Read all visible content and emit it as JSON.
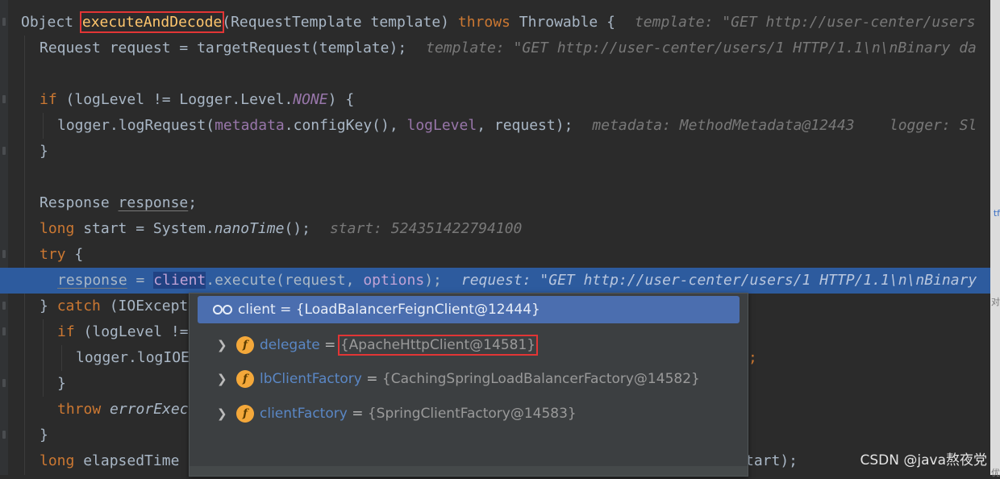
{
  "editor": {
    "method_signature": {
      "ret": "Object ",
      "name": "executeAndDecode",
      "params": "(RequestTemplate template) ",
      "kw": "throws",
      "rest": " Throwable {",
      "hint": "template: \"GET http://user-center/users"
    },
    "lines": {
      "l1": {
        "a": "Request request = targetRequest(template);",
        "hint": "template: \"GET http://user-center/users/1 HTTP/1.1\\n\\nBinary da"
      },
      "l3": {
        "kw": "if",
        "a": " (logLevel != Logger.Level.",
        "fld": "NONE",
        "b": ") {"
      },
      "l4": {
        "a": "logger.logRequest(",
        "fld": "metadata",
        "b": ".configKey(), ",
        "fld2": "logLevel",
        "c": ", request);",
        "hint": "metadata: MethodMetadata@12443    logger: Sl"
      },
      "l5": {
        "a": "}"
      },
      "l7": {
        "a": "Response ",
        "var": "response",
        "b": ";"
      },
      "l8": {
        "kw": "long",
        "a": " start = System.",
        "it": "nanoTime",
        "b": "();",
        "hint": "start: 524351422794100"
      },
      "l9": {
        "kw": "try",
        "a": " {"
      },
      "l10": {
        "var": "response",
        "a": " = ",
        "sel": "client",
        "b": ".execute(request, ",
        "fld": "options",
        "c": ");",
        "hint": "request: \"GET http://user-center/users/1 HTTP/1.1\\n\\nBinary"
      },
      "l11": {
        "a": "} ",
        "kw": "catch",
        "b": " (IOExcept"
      },
      "l12": {
        "kw": "if",
        "a": " (logLevel !="
      },
      "l13": {
        "a": "logger.logIOE",
        "tail": ";"
      },
      "l14": {
        "a": "}"
      },
      "l15": {
        "kw": "throw",
        "it": " errorExec"
      },
      "l16": {
        "a": "}"
      },
      "l17": {
        "kw": "long",
        "a": " elapsedTime",
        "tail": "tart);"
      }
    }
  },
  "popup": {
    "title": "client = {LoadBalancerFeignClient@12444}",
    "rows": [
      {
        "name": "delegate",
        "eq": " = ",
        "value": "{ApacheHttpClient@14581}"
      },
      {
        "name": "lbClientFactory",
        "eq": " = ",
        "value": "{CachingSpringLoadBalancerFactory@14582}"
      },
      {
        "name": "clientFactory",
        "eq": " = ",
        "value": "{SpringClientFactory@14583}"
      }
    ],
    "field_icon_letter": "f",
    "expand_glyph": "❯"
  },
  "right_strip": {
    "top_char": "tf",
    "mid_char": "对",
    "bottom_char": "优"
  },
  "watermark": "CSDN @java熬夜党",
  "colors": {
    "background": "#2b2b2b",
    "keyword": "#cc7832",
    "method": "#ffc66d",
    "field": "#9876aa",
    "execution_line": "#2d5b9e",
    "popup_header": "#4b6eaf",
    "highlight_box": "#e23535"
  }
}
